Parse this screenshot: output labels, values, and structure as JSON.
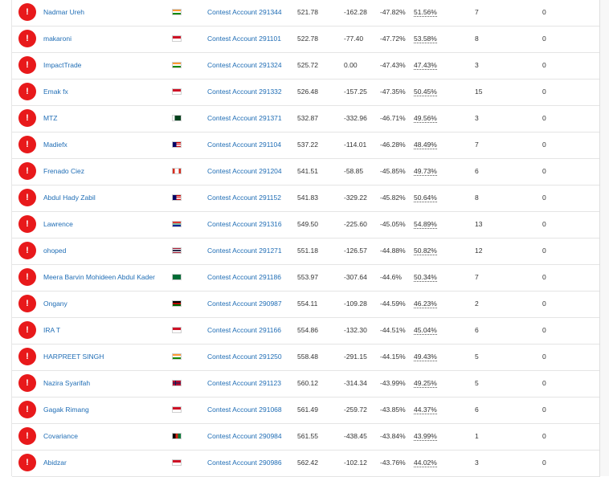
{
  "rows": [
    {
      "name": "Nadmar Ureh",
      "flag": "india",
      "account": "Contest Account 291344",
      "equity": "521.78",
      "profit": "-162.28",
      "gain": "-47.82%",
      "winrate": "51.56%",
      "trades": "7",
      "extra": "0"
    },
    {
      "name": "makaroni",
      "flag": "indonesia",
      "account": "Contest Account 291101",
      "equity": "522.78",
      "profit": "-77.40",
      "gain": "-47.72%",
      "winrate": "53.58%",
      "trades": "8",
      "extra": "0"
    },
    {
      "name": "ImpactTrade",
      "flag": "india",
      "account": "Contest Account 291324",
      "equity": "525.72",
      "profit": "0.00",
      "gain": "-47.43%",
      "winrate": "47.43%",
      "trades": "3",
      "extra": "0"
    },
    {
      "name": "Emak fx",
      "flag": "indonesia",
      "account": "Contest Account 291332",
      "equity": "526.48",
      "profit": "-157.25",
      "gain": "-47.35%",
      "winrate": "50.45%",
      "trades": "15",
      "extra": "0"
    },
    {
      "name": "MTZ",
      "flag": "pakistan",
      "account": "Contest Account 291371",
      "equity": "532.87",
      "profit": "-332.96",
      "gain": "-46.71%",
      "winrate": "49.56%",
      "trades": "3",
      "extra": "0"
    },
    {
      "name": "Madiefx",
      "flag": "malaysia",
      "account": "Contest Account 291104",
      "equity": "537.22",
      "profit": "-114.01",
      "gain": "-46.28%",
      "winrate": "48.49%",
      "trades": "7",
      "extra": "0"
    },
    {
      "name": "Frenado Ciez",
      "flag": "canada",
      "account": "Contest Account 291204",
      "equity": "541.51",
      "profit": "-58.85",
      "gain": "-45.85%",
      "winrate": "49.73%",
      "trades": "6",
      "extra": "0"
    },
    {
      "name": "Abdul Hady Zabil",
      "flag": "malaysia",
      "account": "Contest Account 291152",
      "equity": "541.83",
      "profit": "-329.22",
      "gain": "-45.82%",
      "winrate": "50.64%",
      "trades": "8",
      "extra": "0"
    },
    {
      "name": "Lawrence",
      "flag": "south-africa",
      "account": "Contest Account 291316",
      "equity": "549.50",
      "profit": "-225.60",
      "gain": "-45.05%",
      "winrate": "54.89%",
      "trades": "13",
      "extra": "0"
    },
    {
      "name": "ohoped",
      "flag": "thailand",
      "account": "Contest Account 291271",
      "equity": "551.18",
      "profit": "-126.57",
      "gain": "-44.88%",
      "winrate": "50.82%",
      "trades": "12",
      "extra": "0"
    },
    {
      "name": "Meera Barvin Mohideen Abdul Kader",
      "flag": "saudi-arabia",
      "account": "Contest Account 291186",
      "equity": "553.97",
      "profit": "-307.64",
      "gain": "-44.6%",
      "winrate": "50.34%",
      "trades": "7",
      "extra": "0"
    },
    {
      "name": "Ongany",
      "flag": "kenya",
      "account": "Contest Account 290987",
      "equity": "554.11",
      "profit": "-109.28",
      "gain": "-44.59%",
      "winrate": "46.23%",
      "trades": "2",
      "extra": "0"
    },
    {
      "name": "IRA T",
      "flag": "indonesia",
      "account": "Contest Account 291166",
      "equity": "554.86",
      "profit": "-132.30",
      "gain": "-44.51%",
      "winrate": "45.04%",
      "trades": "6",
      "extra": "0"
    },
    {
      "name": "HARPREET SINGH",
      "flag": "india",
      "account": "Contest Account 291250",
      "equity": "558.48",
      "profit": "-291.15",
      "gain": "-44.15%",
      "winrate": "49.43%",
      "trades": "5",
      "extra": "0"
    },
    {
      "name": "Nazira Syarifah",
      "flag": "norway",
      "account": "Contest Account 291123",
      "equity": "560.12",
      "profit": "-314.34",
      "gain": "-43.99%",
      "winrate": "49.25%",
      "trades": "5",
      "extra": "0"
    },
    {
      "name": "Gagak Rimang",
      "flag": "indonesia",
      "account": "Contest Account 291068",
      "equity": "561.49",
      "profit": "-259.72",
      "gain": "-43.85%",
      "winrate": "44.37%",
      "trades": "6",
      "extra": "0"
    },
    {
      "name": "Covariance",
      "flag": "afghanistan",
      "account": "Contest Account 290984",
      "equity": "561.55",
      "profit": "-438.45",
      "gain": "-43.84%",
      "winrate": "43.99%",
      "trades": "1",
      "extra": "0"
    },
    {
      "name": "Abidzar",
      "flag": "indonesia",
      "account": "Contest Account 290986",
      "equity": "562.42",
      "profit": "-102.12",
      "gain": "-43.76%",
      "winrate": "44.02%",
      "trades": "3",
      "extra": "0"
    }
  ],
  "status_icon_symbol": "!",
  "colors": {
    "alert_red": "#e8191b",
    "link_blue": "#1f6db5",
    "row_border": "#e4e4e4"
  }
}
